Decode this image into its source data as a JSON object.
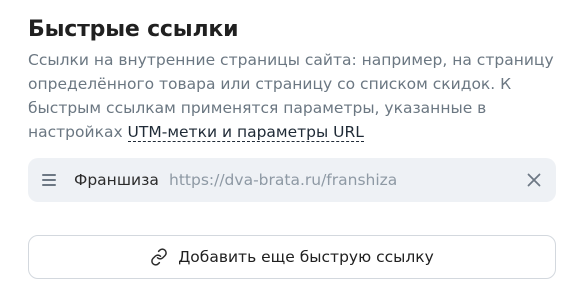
{
  "section": {
    "title": "Быстрые ссылки",
    "description_text": "Ссылки на внутренние страницы сайта: например, на страницу определённого товара или страницу со списком скидок. К быстрым ссылкам применятся параметры, указанные в настройках ",
    "description_link": "UTM-метки и параметры URL"
  },
  "quick_links": [
    {
      "name": "Франшиза",
      "url": "https://dva-brata.ru/franshiza",
      "icons": {
        "drag": "drag-handle-icon",
        "remove": "close-icon"
      }
    }
  ],
  "add_button": {
    "label": "Добавить еще быструю ссылку",
    "icon": "link-icon"
  },
  "colors": {
    "description": "#6b7782",
    "row_background": "#eef1f5",
    "url_text": "#8e99a4",
    "border": "#d3d8de"
  }
}
